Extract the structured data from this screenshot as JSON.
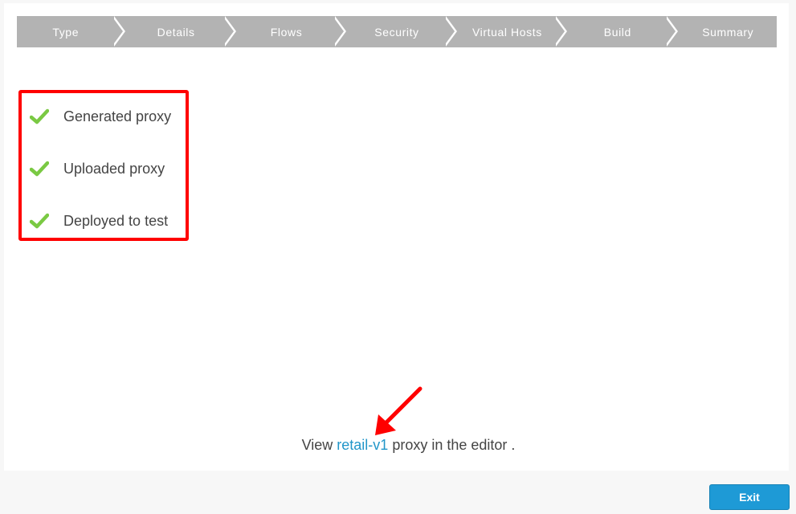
{
  "wizard": {
    "steps": [
      {
        "label": "Type"
      },
      {
        "label": "Details"
      },
      {
        "label": "Flows"
      },
      {
        "label": "Security"
      },
      {
        "label": "Virtual Hosts"
      },
      {
        "label": "Build"
      },
      {
        "label": "Summary"
      }
    ]
  },
  "status": {
    "items": [
      {
        "label": "Generated proxy",
        "icon": "check-icon",
        "state": "done"
      },
      {
        "label": "Uploaded proxy",
        "icon": "check-icon",
        "state": "done"
      },
      {
        "label": "Deployed to test",
        "icon": "check-icon",
        "state": "done"
      }
    ],
    "highlight_color": "#ff0000",
    "check_color": "#7ac943"
  },
  "view": {
    "prefix": "View",
    "link": "retail-v1",
    "suffix": "proxy in the editor ."
  },
  "footer": {
    "exit_label": "Exit"
  },
  "colors": {
    "step_bg": "#b3b3b3",
    "link": "#2196c9",
    "button": "#1e9ad6"
  }
}
